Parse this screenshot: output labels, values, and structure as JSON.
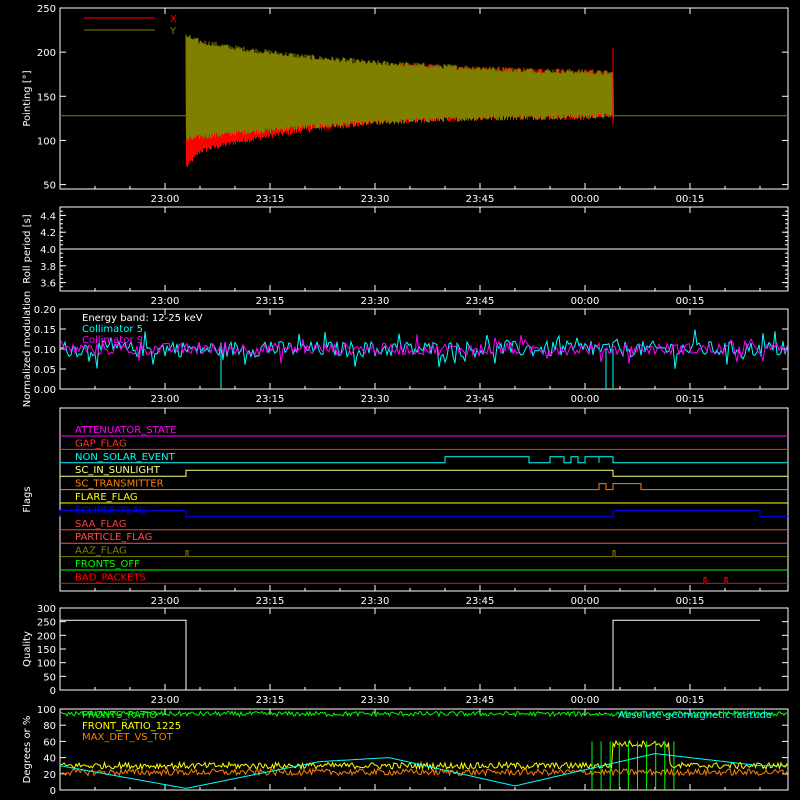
{
  "chart_data": [
    {
      "type": "line",
      "ylabel": "Pointing [°]",
      "ylim": [
        45,
        250
      ],
      "yticks": [
        "50",
        "100",
        "150",
        "200",
        "250"
      ],
      "xticks": [
        "23:00",
        "23:15",
        "23:30",
        "23:45",
        "00:00",
        "00:15"
      ],
      "legend_position": "top-left",
      "series": [
        {
          "name": "X",
          "color": "#ff0000",
          "x": [
            "23:03",
            "23:05",
            "23:10",
            "23:20",
            "23:30",
            "23:40",
            "23:50",
            "00:00",
            "00:04"
          ],
          "min": [
            70,
            88,
            98,
            112,
            120,
            124,
            126,
            126,
            128
          ],
          "max": [
            212,
            203,
            198,
            190,
            186,
            182,
            180,
            178,
            177
          ]
        },
        {
          "name": "Y",
          "color": "#808000",
          "x": [
            "23:03",
            "23:05",
            "23:10",
            "23:20",
            "23:30",
            "23:40",
            "23:50",
            "00:00",
            "00:04"
          ],
          "min": [
            100,
            104,
            108,
            115,
            120,
            124,
            126,
            127,
            128
          ],
          "max": [
            218,
            212,
            205,
            195,
            188,
            184,
            180,
            178,
            176
          ]
        }
      ],
      "baseline": 128
    },
    {
      "type": "line",
      "ylabel": "Roll period [s]",
      "ylim": [
        3.5,
        4.5
      ],
      "yticks": [
        "3.6",
        "3.8",
        "4.0",
        "4.2",
        "4.4"
      ],
      "xticks": [
        "23:00",
        "23:15",
        "23:30",
        "23:45",
        "00:00",
        "00:15"
      ],
      "series": [
        {
          "name": "",
          "color": "#ffffff",
          "x": [
            "22:45",
            "00:25"
          ],
          "y": [
            4.0,
            4.0
          ]
        }
      ]
    },
    {
      "type": "line",
      "ylabel": "Normalized modulation",
      "ylim": [
        0,
        0.2
      ],
      "yticks": [
        "0.00",
        "0.05",
        "0.10",
        "0.15",
        "0.20"
      ],
      "xticks": [
        "23:00",
        "23:15",
        "23:30",
        "23:45",
        "00:00",
        "00:15"
      ],
      "annotations": [
        "Energy band: 12-25 keV",
        "Collimator 5",
        "Collimator 9"
      ],
      "series": [
        {
          "name": "Collimator 5",
          "color": "#00ffff",
          "mean": 0.1,
          "spread": 0.02
        },
        {
          "name": "Collimator 9",
          "color": "#ff00ff",
          "mean": 0.1,
          "spread": 0.015
        }
      ]
    },
    {
      "type": "line",
      "ylabel": "Flags",
      "xticks": [
        "23:00",
        "23:15",
        "23:30",
        "23:45",
        "00:00",
        "00:15"
      ],
      "flags": [
        {
          "name": "ATTENUATOR_STATE",
          "color": "#ff00ff",
          "on": []
        },
        {
          "name": "GAP_FLAG",
          "color": "#ff3030",
          "on": []
        },
        {
          "name": "NON_SOLAR_EVENT",
          "color": "#00ffff",
          "on": [
            [
              "23:40",
              "23:52"
            ],
            [
              "23:55",
              "23:57"
            ],
            [
              "23:58",
              "23:59"
            ],
            [
              "00:00",
              "00:02"
            ],
            [
              "00:02",
              "00:04"
            ]
          ]
        },
        {
          "name": "SC_IN_SUNLIGHT",
          "color": "#ffff80",
          "on": [
            [
              "23:03",
              "00:04"
            ]
          ]
        },
        {
          "name": "SC_TRANSMITTER",
          "color": "#ff8000",
          "on": [
            [
              "00:02",
              "00:03"
            ],
            [
              "00:04",
              "00:08"
            ]
          ]
        },
        {
          "name": "FLARE_FLAG",
          "color": "#ffff00",
          "on": []
        },
        {
          "name": "ECLIPSE_FLAG",
          "color": "#0000ff",
          "on": [
            [
              "22:45",
              "23:03"
            ],
            [
              "00:04",
              "00:25"
            ]
          ]
        },
        {
          "name": "SAA_FLAG",
          "color": "#ff4040",
          "on": []
        },
        {
          "name": "PARTICLE_FLAG",
          "color": "#ff5050",
          "on": []
        },
        {
          "name": "AAZ_FLAG",
          "color": "#808000",
          "on": [
            [
              "23:03",
              "23:03"
            ],
            [
              "00:04",
              "00:04"
            ]
          ]
        },
        {
          "name": "FRONTS_OFF",
          "color": "#00ff00",
          "on": []
        },
        {
          "name": "BAD_PACKETS",
          "color": "#ff0000",
          "on": [
            [
              "00:17",
              "00:17"
            ],
            [
              "00:20",
              "00:20"
            ]
          ]
        }
      ]
    },
    {
      "type": "line",
      "ylabel": "Quality",
      "ylim": [
        0,
        300
      ],
      "yticks": [
        "0",
        "50",
        "100",
        "150",
        "200",
        "250",
        "300"
      ],
      "xticks": [
        "23:00",
        "23:15",
        "23:30",
        "23:45",
        "00:00",
        "00:15"
      ],
      "series": [
        {
          "name": "",
          "color": "#ffffff",
          "x": [
            "22:45",
            "23:03",
            "23:03",
            "00:04",
            "00:04",
            "00:25"
          ],
          "y": [
            255,
            255,
            0,
            0,
            255,
            255
          ]
        }
      ]
    },
    {
      "type": "line",
      "ylabel": "Degrees or %",
      "ylim": [
        0,
        100
      ],
      "yticks": [
        "0",
        "20",
        "40",
        "60",
        "80",
        "100"
      ],
      "xticks": [
        "23:00",
        "23:15",
        "23:30",
        "23:45",
        "00:00",
        "00:15"
      ],
      "legend_position": "top-left",
      "annotation": "Absolute geomagnetic latitude",
      "series": [
        {
          "name": "FRONTS_RATIO",
          "color": "#00ff00",
          "mean": 94
        },
        {
          "name": "FRONT_RATIO_1225",
          "color": "#ffff00",
          "mean": 30
        },
        {
          "name": "MAX_DET_VS_TOT",
          "color": "#ff8000",
          "mean": 22
        },
        {
          "name": "Absolute geomagnetic latitude",
          "color": "#00ffff",
          "x": [
            "22:45",
            "23:03",
            "23:22",
            "23:32",
            "23:50",
            "00:10",
            "00:25"
          ],
          "y": [
            30,
            2,
            35,
            40,
            5,
            45,
            30
          ]
        }
      ]
    }
  ]
}
